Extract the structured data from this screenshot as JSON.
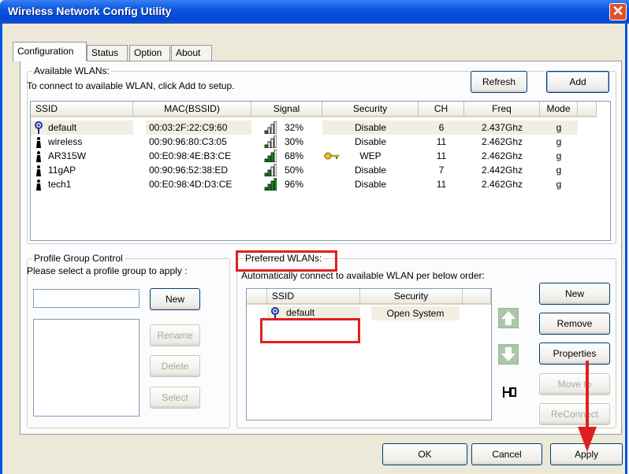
{
  "window": {
    "title": "Wireless Network Config Utility",
    "close_glyph": "✕"
  },
  "tabs": [
    {
      "label": "Configuration"
    },
    {
      "label": "Status"
    },
    {
      "label": "Option"
    },
    {
      "label": "About"
    }
  ],
  "available": {
    "group_label": "Available WLANs:",
    "instruction": "To connect to available WLAN, click Add to setup.",
    "refresh_label": "Refresh",
    "add_label": "Add",
    "columns": [
      "SSID",
      "MAC(BSSID)",
      "Signal",
      "Security",
      "CH",
      "Freq",
      "Mode"
    ],
    "rows": [
      {
        "ssid": "default",
        "mac": "00:03:2F:22:C9:60",
        "signal": "32%",
        "security": "Disable",
        "ch": "6",
        "freq": "2.437Ghz",
        "mode": "g",
        "connected": true,
        "locked": false,
        "signal_level": 0.32
      },
      {
        "ssid": "wireless",
        "mac": "00:90:96:80:C3:05",
        "signal": "30%",
        "security": "Disable",
        "ch": "11",
        "freq": "2.462Ghz",
        "mode": "g",
        "connected": false,
        "locked": false,
        "signal_level": 0.3
      },
      {
        "ssid": "AR315W",
        "mac": "00:E0:98:4E:B3:CE",
        "signal": "68%",
        "security": "WEP",
        "ch": "11",
        "freq": "2.462Ghz",
        "mode": "g",
        "connected": false,
        "locked": true,
        "signal_level": 0.68
      },
      {
        "ssid": "11gAP",
        "mac": "00:90:96:52:38:ED",
        "signal": "50%",
        "security": "Disable",
        "ch": "7",
        "freq": "2.442Ghz",
        "mode": "g",
        "connected": false,
        "locked": false,
        "signal_level": 0.5
      },
      {
        "ssid": "tech1",
        "mac": "00:E0:98:4D:D3:CE",
        "signal": "96%",
        "security": "Disable",
        "ch": "11",
        "freq": "2.462Ghz",
        "mode": "g",
        "connected": false,
        "locked": false,
        "signal_level": 0.96
      }
    ]
  },
  "profile_group": {
    "group_label": "Profile Group Control",
    "instruction": "Please select a profile group to apply :",
    "name_value": "",
    "new_label": "New",
    "rename_label": "Rename",
    "delete_label": "Delete",
    "select_label": "Select"
  },
  "preferred": {
    "group_label": "Preferred WLANs:",
    "instruction": "Automatically connect to available WLAN per below order:",
    "columns": [
      "SSID",
      "Security"
    ],
    "rows": [
      {
        "ssid": "default",
        "security": "Open System"
      }
    ],
    "new_label": "New",
    "remove_label": "Remove",
    "properties_label": "Properties",
    "move_to_label": "Move to",
    "reconnect_label": "ReConnect"
  },
  "footer": {
    "ok_label": "OK",
    "cancel_label": "Cancel",
    "apply_label": "Apply"
  },
  "colors": {
    "highlight_red": "#e0201e",
    "title_blue": "#0a56e0",
    "signal_green": "#1a9c1a"
  }
}
